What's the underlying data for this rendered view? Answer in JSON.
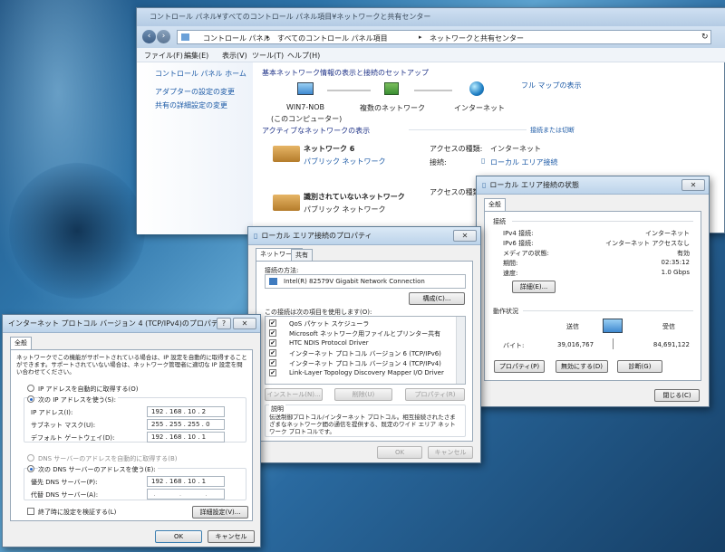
{
  "cp": {
    "title": "コントロール パネル¥すべてのコントロール パネル項目¥ネットワークと共有センター",
    "breadcrumb": [
      "コントロール パネル",
      "すべてのコントロール パネル項目",
      "ネットワークと共有センター"
    ],
    "menu": [
      "ファイル(F)",
      "編集(E)",
      "表示(V)",
      "ツール(T)",
      "ヘルプ(H)"
    ],
    "sidebar": [
      "コントロール パネル ホーム",
      "アダプターの設定の変更",
      "共有の詳細設定の変更"
    ],
    "heading": "基本ネットワーク情報の表示と接続のセットアップ",
    "fullmap": "フル マップの表示",
    "nodes": [
      {
        "label": "WIN7-NOB",
        "sub": "(このコンピューター)"
      },
      {
        "label": "複数のネットワーク",
        "sub": ""
      },
      {
        "label": "インターネット",
        "sub": ""
      }
    ],
    "active_heading": "アクティブなネットワークの表示",
    "connect_link": "接続または切断",
    "net1": {
      "name": "ネットワーク 6",
      "type": "パブリック ネットワーク",
      "access_label": "アクセスの種類:",
      "access_value": "インターネット",
      "conn_label": "接続:",
      "conn_value": "ローカル エリア接続"
    },
    "net2": {
      "name": "識別されていないネットワーク",
      "type": "パブリック ネットワーク",
      "access_label": "アクセスの種類:"
    }
  },
  "status": {
    "title": "ローカル エリア接続の状態",
    "tab": "全般",
    "conn_header": "接続",
    "rows": [
      {
        "k": "IPv4 接続:",
        "v": "インターネット"
      },
      {
        "k": "IPv6 接続:",
        "v": "インターネット アクセスなし"
      },
      {
        "k": "メディアの状態:",
        "v": "有効"
      },
      {
        "k": "期間:",
        "v": "02:35:12"
      },
      {
        "k": "速度:",
        "v": "1.0 Gbps"
      }
    ],
    "details_btn": "詳細(E)...",
    "activity_header": "動作状況",
    "sent": "送信",
    "recv": "受信",
    "bytes_label": "バイト:",
    "bytes_sent": "39,016,767",
    "bytes_recv": "84,691,122",
    "props_btn": "プロパティ(P)",
    "disable_btn": "無効にする(D)",
    "diag_btn": "診断(G)",
    "close_btn": "閉じる(C)"
  },
  "props": {
    "title": "ローカル エリア接続のプロパティ",
    "tabs": [
      "ネットワーク",
      "共有"
    ],
    "connect_using": "接続の方法:",
    "adapter": "Intel(R) 82579V Gigabit Network Connection",
    "config_btn": "構成(C)...",
    "items_label": "この接続は次の項目を使用します(O):",
    "items": [
      "QoS パケット スケジューラ",
      "Microsoft ネットワーク用ファイルとプリンター共有",
      "HTC NDIS Protocol Driver",
      "インターネット プロトコル バージョン 6 (TCP/IPv6)",
      "インターネット プロトコル バージョン 4 (TCP/IPv4)",
      "Link-Layer Topology Discovery Mapper I/O Driver"
    ],
    "install_btn": "インストール(N)...",
    "uninstall_btn": "削除(U)",
    "properties_btn": "プロパティ(R)",
    "desc_label": "説明",
    "desc_text": "伝送制御プロトコル/インターネット プロトコル。相互接続されたさまざまなネットワーク間の通信を提供する、既定のワイド エリア ネットワーク プロトコルです。",
    "ok_btn": "OK",
    "cancel_btn": "キャンセル"
  },
  "ipv4": {
    "title": "インターネット プロトコル バージョン 4 (TCP/IPv4)のプロパティ",
    "tab": "全般",
    "intro": "ネットワークでこの機能がサポートされている場合は、IP 設定を自動的に取得することができます。サポートされていない場合は、ネットワーク管理者に適切な IP 設定を問い合わせてください。",
    "auto_ip": "IP アドレスを自動的に取得する(O)",
    "manual_ip": "次の IP アドレスを使う(S):",
    "ip_label": "IP アドレス(I):",
    "ip": "192 . 168 . 10 . 2",
    "mask_label": "サブネット マスク(U):",
    "mask": "255 . 255 . 255 . 0",
    "gw_label": "デフォルト ゲートウェイ(D):",
    "gw": "192 . 168 . 10 . 1",
    "auto_dns": "DNS サーバーのアドレスを自動的に取得する(B)",
    "manual_dns": "次の DNS サーバーのアドレスを使う(E):",
    "dns1_label": "優先 DNS サーバー(P):",
    "dns1": "192 . 168 . 10 . 1",
    "dns2_label": "代替 DNS サーバー(A):",
    "dns2": ". . .",
    "validate": "終了時に設定を検証する(L)",
    "advanced_btn": "詳細設定(V)...",
    "ok_btn": "OK",
    "cancel_btn": "キャンセル"
  }
}
